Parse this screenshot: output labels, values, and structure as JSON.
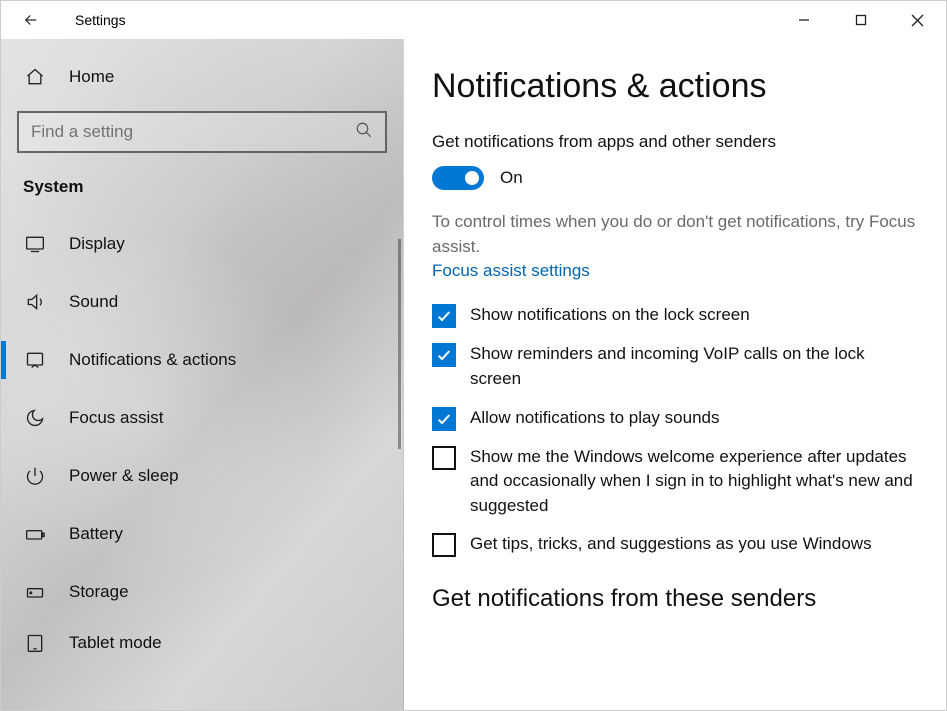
{
  "window": {
    "title": "Settings"
  },
  "sidebar": {
    "home_label": "Home",
    "search_placeholder": "Find a setting",
    "section_label": "System",
    "items": [
      {
        "label": "Display",
        "icon": "display"
      },
      {
        "label": "Sound",
        "icon": "sound"
      },
      {
        "label": "Notifications & actions",
        "icon": "notifications",
        "active": true
      },
      {
        "label": "Focus assist",
        "icon": "moon"
      },
      {
        "label": "Power & sleep",
        "icon": "power"
      },
      {
        "label": "Battery",
        "icon": "battery"
      },
      {
        "label": "Storage",
        "icon": "storage"
      },
      {
        "label": "Tablet mode",
        "icon": "tablet"
      }
    ]
  },
  "main": {
    "title": "Notifications & actions",
    "toggle_heading": "Get notifications from apps and other senders",
    "toggle_state": "On",
    "help_text": "To control times when you do or don't get notifications, try Focus assist.",
    "link_label": "Focus assist settings",
    "checkboxes": [
      {
        "label": "Show notifications on the lock screen",
        "checked": true
      },
      {
        "label": "Show reminders and incoming VoIP calls on the lock screen",
        "checked": true
      },
      {
        "label": "Allow notifications to play sounds",
        "checked": true
      },
      {
        "label": "Show me the Windows welcome experience after updates and occasionally when I sign in to highlight what's new and suggested",
        "checked": false
      },
      {
        "label": "Get tips, tricks, and suggestions as you use Windows",
        "checked": false
      }
    ],
    "section2_title": "Get notifications from these senders"
  }
}
